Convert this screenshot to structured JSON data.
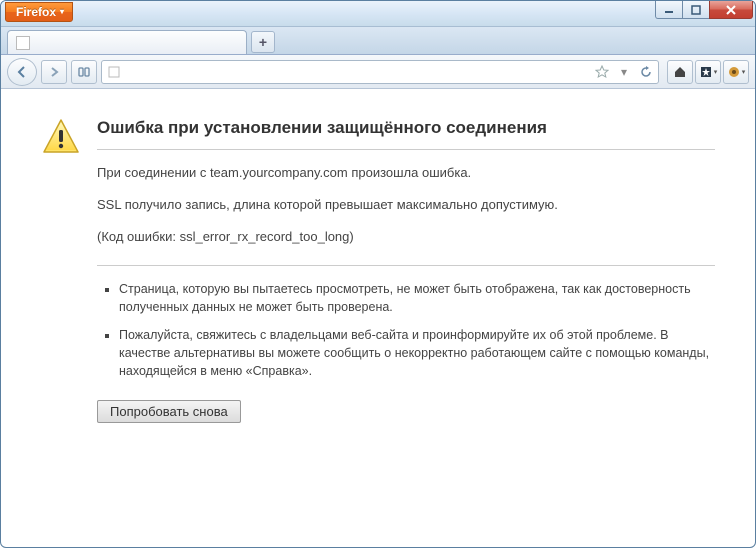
{
  "window": {
    "app_menu_label": "Firefox"
  },
  "addressbar": {
    "value": ""
  },
  "error": {
    "title": "Ошибка при установлении защищённого соединения",
    "line1": "При соединении с team.yourcompany.com произошла ошибка.",
    "line2": "SSL получило запись, длина которой превышает максимально допустимую.",
    "code_line": "(Код ошибки: ssl_error_rx_record_too_long)",
    "bullets": [
      "Страница, которую вы пытаетесь просмотреть, не может быть отображена, так как достоверность полученных данных не может быть проверена.",
      "Пожалуйста, свяжитесь с владельцами веб-сайта и проинформируйте их об этой проблеме. В качестве альтернативы вы можете сообщить о некорректно работающем сайте с помощью команды, находящейся в меню «Справка»."
    ],
    "retry_label": "Попробовать снова"
  }
}
